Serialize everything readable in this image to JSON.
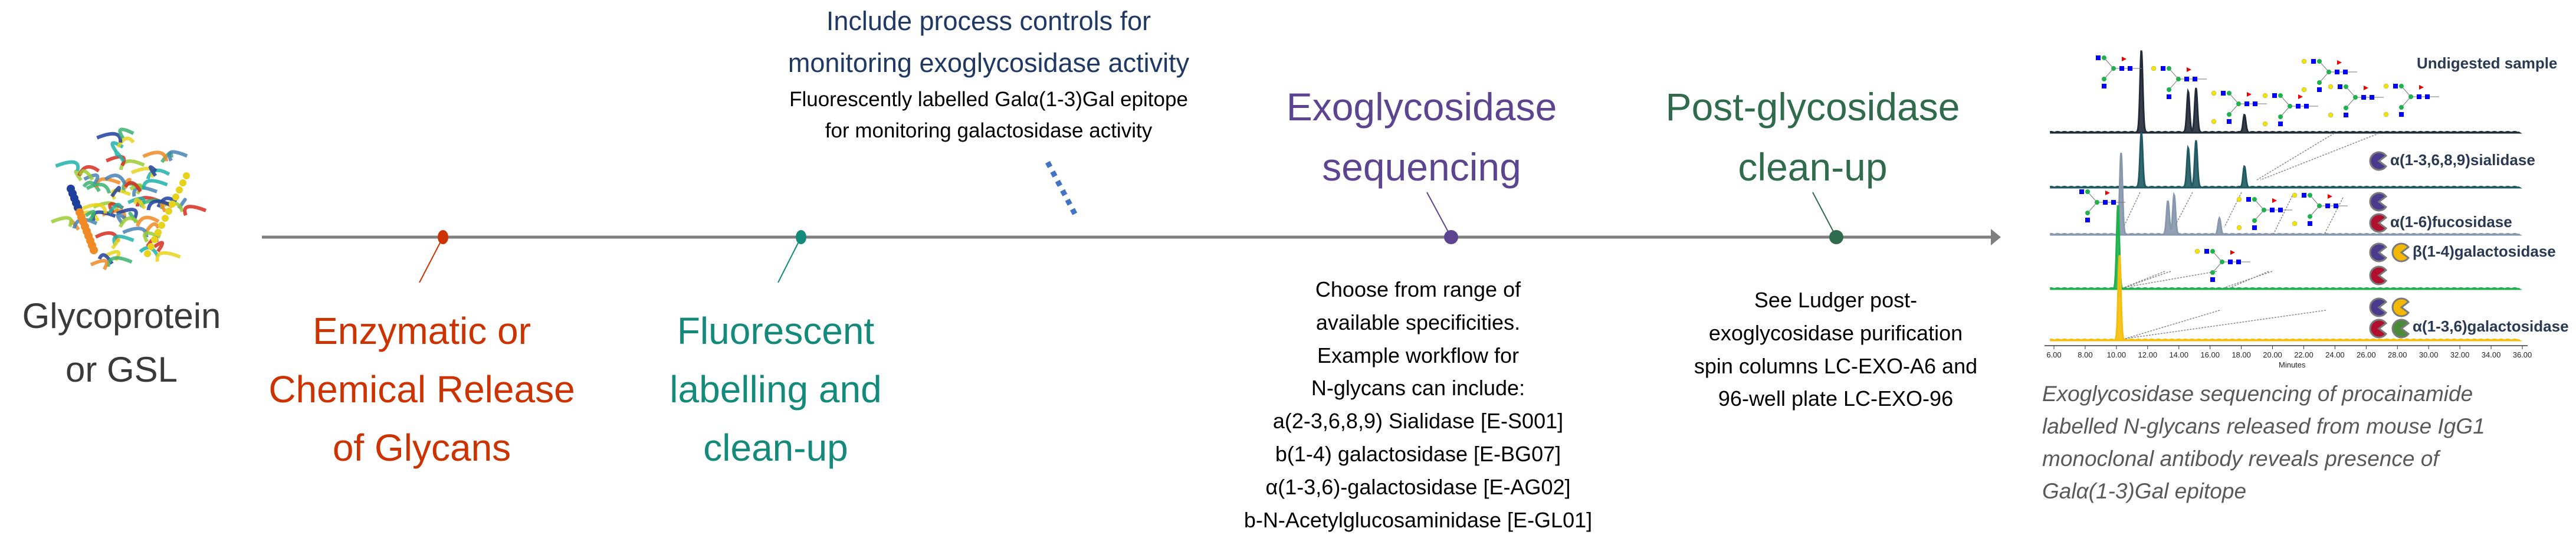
{
  "start": {
    "lines": [
      "Glycoprotein",
      "or GSL"
    ],
    "image": "glycoprotein-ribbon-structure"
  },
  "steps": [
    {
      "lines": [
        "Enzymatic or",
        "Chemical Release",
        "of Glycans"
      ],
      "color": "#cc3300"
    },
    {
      "lines": [
        "Fluorescent",
        "labelling and",
        "clean-up"
      ],
      "color": "#138a7a"
    },
    {
      "lines": [
        "Exoglycosidase",
        "sequencing"
      ],
      "color": "#5c4490"
    },
    {
      "lines": [
        "Post-glycosidase",
        "clean-up"
      ],
      "color": "#2f6b4c"
    }
  ],
  "process_controls": {
    "title_lines": [
      "Include process controls for",
      "monitoring exoglycosidase activity"
    ],
    "detail_lines": [
      "Fluorescently labelled Galα(1-3)Gal epitope",
      "for monitoring galactosidase activity"
    ],
    "connector_color": "#4472c4"
  },
  "exo_notes": {
    "lines": [
      "Choose from range of",
      "available specificities.",
      "Example workflow for",
      "N-glycans can include:",
      "a(2-3,6,8,9) Sialidase [E-S001]",
      "b(1-4) galactosidase [E-BG07]",
      "α(1-3,6)-galactosidase [E-AG02]",
      "b-N-Acetylglucosaminidase [E-GL01]"
    ]
  },
  "cleanup_notes": {
    "lines": [
      "See Ludger post-",
      "exoglycosidase purification",
      "spin columns LC-EXO-A6 and",
      "96-well plate LC-EXO-96"
    ]
  },
  "timeline_color": "#7f7f7f",
  "chart_data": {
    "type": "line",
    "xlabel": "Minutes",
    "xlim": [
      6,
      36
    ],
    "x_ticks": [
      "6.00",
      "8.00",
      "10.00",
      "12.00",
      "14.00",
      "16.00",
      "18.00",
      "20.00",
      "22.00",
      "24.00",
      "26.00",
      "28.00",
      "30.00",
      "32.00",
      "34.00",
      "36.00"
    ],
    "series": [
      {
        "name": "Undigested sample",
        "color": "#222b38",
        "peaks": [
          [
            11.6,
            1.0
          ],
          [
            14.6,
            0.5
          ],
          [
            15.1,
            0.54
          ],
          [
            18.2,
            0.21
          ]
        ],
        "enzymes": []
      },
      {
        "name": "α(1-3,6,8,9)sialidase",
        "color": "#1f5a62",
        "peaks": [
          [
            11.6,
            0.67
          ],
          [
            14.6,
            0.48
          ],
          [
            15.1,
            0.57
          ],
          [
            18.2,
            0.25
          ]
        ],
        "enzymes": [
          "#4b3b8f"
        ]
      },
      {
        "name": "α(1-6)fucosidase",
        "color": "#8797ad",
        "peaks": [
          [
            10.3,
            0.99
          ],
          [
            13.3,
            0.41
          ],
          [
            13.7,
            0.48
          ],
          [
            16.6,
            0.19
          ]
        ],
        "enzymes": [
          "#4b3b8f",
          "#b0102e"
        ]
      },
      {
        "name": "β(1-4)galactosidase",
        "color": "#1fb14d",
        "peaks": [
          [
            10.1,
            1.01
          ]
        ],
        "enzymes": [
          "#4b3b8f",
          "#f5b800",
          "#b0102e"
        ]
      },
      {
        "name": "α(1-3,6)galactosidase",
        "color": "#f5be0b",
        "peaks": [
          [
            10.2,
            1.03
          ]
        ],
        "enzymes": [
          "#4b3b8f",
          "#f5b800",
          "#b0102e",
          "#4a8a3a"
        ]
      }
    ],
    "caption_lines": [
      "Exoglycosidase sequencing of procainamide",
      "labelled N-glycans released from mouse IgG1",
      "monoclonal antibody reveals presence of",
      "Galα(1-3)Gal epitope"
    ]
  }
}
